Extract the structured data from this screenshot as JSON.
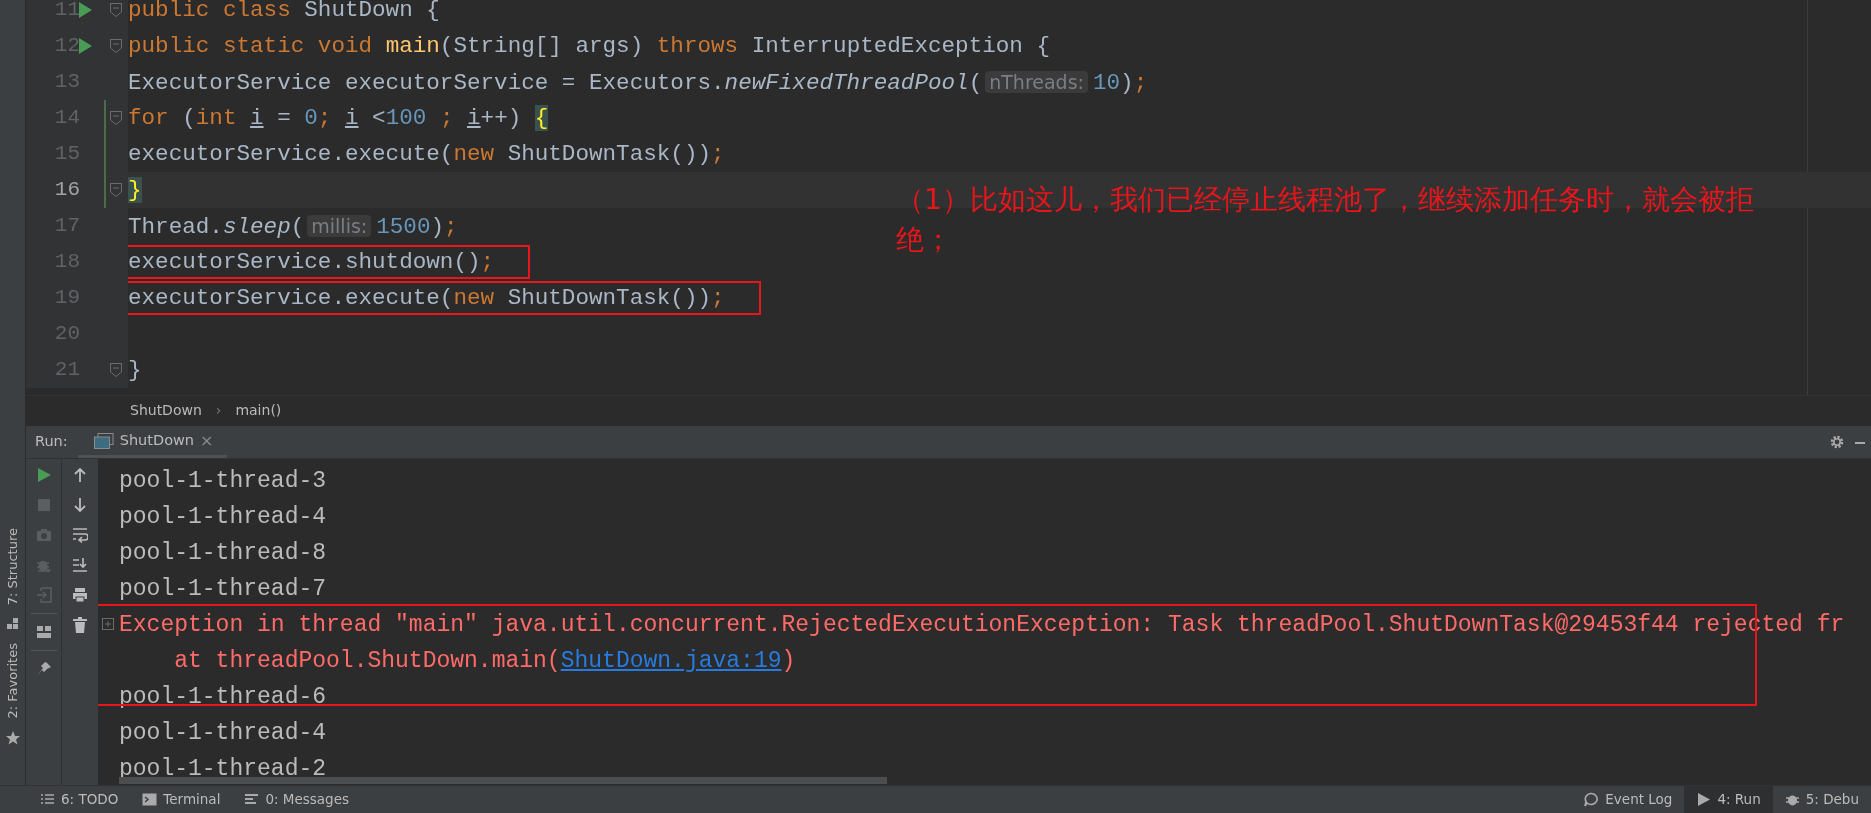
{
  "left_strip": {
    "tabs": [
      {
        "label": "7: Structure",
        "selected": false
      },
      {
        "label": "2: Favorites",
        "selected": false
      }
    ]
  },
  "editor": {
    "lines": [
      {
        "number": "11",
        "run": true,
        "fold": true,
        "current": false,
        "changed": false,
        "boxed": false,
        "tokens": [
          {
            "kind": "keyword",
            "text": "public class "
          },
          {
            "kind": "plain",
            "text": "ShutDown {"
          }
        ]
      },
      {
        "number": "12",
        "run": true,
        "fold": true,
        "current": false,
        "changed": false,
        "boxed": false,
        "tokens": [
          {
            "kind": "keyword",
            "text": "    public static void "
          },
          {
            "kind": "method",
            "text": "main"
          },
          {
            "kind": "plain",
            "text": "(String[] args) "
          },
          {
            "kind": "keyword",
            "text": "throws "
          },
          {
            "kind": "plain",
            "text": "InterruptedException {"
          }
        ]
      },
      {
        "number": "13",
        "run": false,
        "fold": false,
        "current": false,
        "changed": false,
        "boxed": false,
        "tokens": [
          {
            "kind": "plain",
            "text": "        ExecutorService executorService = Executors."
          },
          {
            "kind": "italic",
            "text": "newFixedThreadPool"
          },
          {
            "kind": "plain",
            "text": "("
          },
          {
            "kind": "hint",
            "text": "nThreads:"
          },
          {
            "kind": "number",
            "text": "10"
          },
          {
            "kind": "plain",
            "text": ")"
          },
          {
            "kind": "keyword",
            "text": ";"
          }
        ]
      },
      {
        "number": "14",
        "run": false,
        "fold": true,
        "current": false,
        "changed": true,
        "boxed": false,
        "tokens": [
          {
            "kind": "keyword",
            "text": "        for "
          },
          {
            "kind": "plain",
            "text": "("
          },
          {
            "kind": "keyword",
            "text": "int "
          },
          {
            "kind": "var",
            "text": "i"
          },
          {
            "kind": "plain",
            "text": " = "
          },
          {
            "kind": "number",
            "text": "0"
          },
          {
            "kind": "keyword",
            "text": "; "
          },
          {
            "kind": "var",
            "text": "i"
          },
          {
            "kind": "plain",
            "text": " <"
          },
          {
            "kind": "number",
            "text": "100"
          },
          {
            "kind": "keyword",
            "text": " ; "
          },
          {
            "kind": "var",
            "text": "i"
          },
          {
            "kind": "plain",
            "text": "++) "
          },
          {
            "kind": "brace",
            "text": "{"
          }
        ]
      },
      {
        "number": "15",
        "run": false,
        "fold": false,
        "current": false,
        "changed": true,
        "boxed": false,
        "tokens": [
          {
            "kind": "plain",
            "text": "            executorService.execute("
          },
          {
            "kind": "keyword",
            "text": "new "
          },
          {
            "kind": "plain",
            "text": "ShutDownTask())"
          },
          {
            "kind": "keyword",
            "text": ";"
          }
        ]
      },
      {
        "number": "16",
        "run": false,
        "fold": true,
        "current": true,
        "changed": true,
        "boxed": false,
        "tokens": [
          {
            "kind": "brace",
            "text": "        }"
          }
        ]
      },
      {
        "number": "17",
        "run": false,
        "fold": false,
        "current": false,
        "changed": false,
        "boxed": false,
        "tokens": [
          {
            "kind": "plain",
            "text": "        Thread."
          },
          {
            "kind": "italic",
            "text": "sleep"
          },
          {
            "kind": "plain",
            "text": "("
          },
          {
            "kind": "hint",
            "text": "millis:"
          },
          {
            "kind": "number",
            "text": "1500"
          },
          {
            "kind": "plain",
            "text": ")"
          },
          {
            "kind": "keyword",
            "text": ";"
          }
        ]
      },
      {
        "number": "18",
        "run": false,
        "fold": false,
        "current": false,
        "changed": false,
        "boxed": true,
        "tokens": [
          {
            "kind": "plain",
            "text": "        executorService.shutdown()"
          },
          {
            "kind": "keyword",
            "text": ";"
          }
        ]
      },
      {
        "number": "19",
        "run": false,
        "fold": false,
        "current": false,
        "changed": false,
        "boxed": true,
        "tokens": [
          {
            "kind": "plain",
            "text": "        executorService.execute("
          },
          {
            "kind": "keyword",
            "text": "new "
          },
          {
            "kind": "plain",
            "text": "ShutDownTask())"
          },
          {
            "kind": "keyword",
            "text": ";"
          }
        ]
      },
      {
        "number": "20",
        "run": false,
        "fold": false,
        "current": false,
        "changed": false,
        "boxed": false
      },
      {
        "number": "21",
        "run": false,
        "fold": true,
        "current": false,
        "changed": false,
        "boxed": false,
        "tokens": [
          {
            "kind": "plain",
            "text": "    }"
          }
        ]
      }
    ],
    "annotation": "（1）比如这儿，我们已经停止线程池了，继续添加任务时，就会被拒绝；"
  },
  "breadcrumb": {
    "items": [
      "ShutDown",
      "main()"
    ],
    "separator": "›"
  },
  "run_panel": {
    "label": "Run:",
    "tabs": [
      {
        "label": "ShutDown",
        "selected": true,
        "close": "×"
      }
    ]
  },
  "console": {
    "lines": [
      {
        "kind": "output",
        "boxed": false,
        "tokens": [
          {
            "kind": "plain",
            "text": "pool-1-thread-3"
          }
        ]
      },
      {
        "kind": "output",
        "boxed": false,
        "tokens": [
          {
            "kind": "plain",
            "text": "pool-1-thread-4"
          }
        ]
      },
      {
        "kind": "output",
        "boxed": false,
        "tokens": [
          {
            "kind": "plain",
            "text": "pool-1-thread-8"
          }
        ]
      },
      {
        "kind": "output",
        "boxed": false,
        "tokens": [
          {
            "kind": "plain",
            "text": "pool-1-thread-7"
          }
        ]
      },
      {
        "kind": "error",
        "boxed": true,
        "foldable": true,
        "tokens": [
          {
            "kind": "plain",
            "text": "Exception in thread \"main\" java.util.concurrent.RejectedExecutionException: Task threadPool.ShutDownTask@29453f44 rejected fr"
          }
        ]
      },
      {
        "kind": "error",
        "boxed": true,
        "tokens": [
          {
            "kind": "plain",
            "text": "    at threadPool.ShutDown.main("
          },
          {
            "kind": "link",
            "text": "ShutDown.java:19"
          },
          {
            "kind": "plain",
            "text": ")"
          }
        ]
      },
      {
        "kind": "output",
        "boxed": false,
        "tokens": [
          {
            "kind": "plain",
            "text": "pool-1-thread-6"
          }
        ]
      },
      {
        "kind": "output",
        "boxed": false,
        "tokens": [
          {
            "kind": "plain",
            "text": "pool-1-thread-4"
          }
        ]
      },
      {
        "kind": "output",
        "boxed": false,
        "tokens": [
          {
            "kind": "plain",
            "text": "pool-1-thread-2"
          }
        ]
      }
    ]
  },
  "status_bar": {
    "left": [
      {
        "label": "6: TODO",
        "selected": false
      },
      {
        "label": "Terminal",
        "selected": false
      },
      {
        "label": "0: Messages",
        "selected": false
      }
    ],
    "right": [
      {
        "label": "Event Log",
        "selected": false
      },
      {
        "label": "4: Run",
        "selected": true
      },
      {
        "label": "5: Debu",
        "selected": false
      }
    ]
  }
}
